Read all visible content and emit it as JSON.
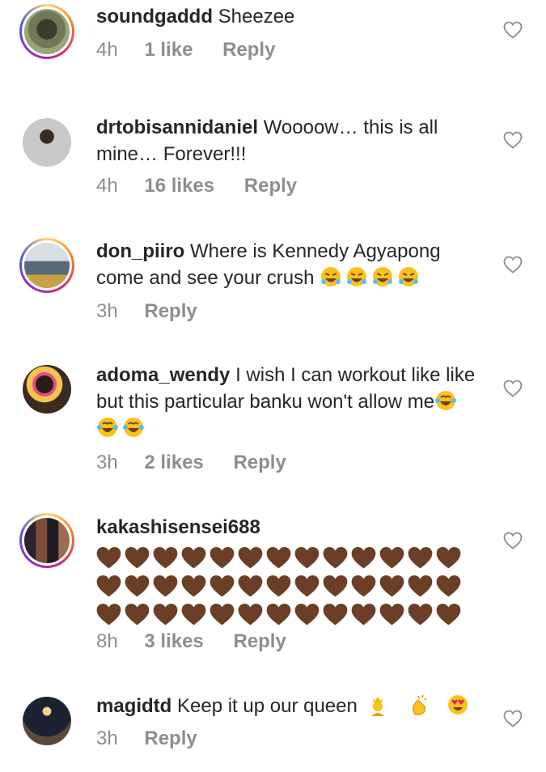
{
  "comments": [
    {
      "username": "soundgaddd",
      "text": "Sheezee",
      "time": "4h",
      "likes": "1 like",
      "reply": "Reply",
      "avatar_ring": true
    },
    {
      "username": "drtobisannidaniel",
      "text": "Woooow… this is all mine… Forever!!!",
      "time": "4h",
      "likes": "16 likes",
      "reply": "Reply",
      "avatar_ring": false
    },
    {
      "username": "don_piiro",
      "text": "Where is Kennedy Agyapong come and see your crush",
      "emojis": [
        "rofl-emoji",
        "rofl-emoji",
        "rofl-emoji",
        "rofl-emoji"
      ],
      "time": "3h",
      "likes": "",
      "reply": "Reply",
      "avatar_ring": true
    },
    {
      "username": "adoma_wendy",
      "text": "I wish I can workout like like but this particular banku won't allow me",
      "emojis": [
        "tears-of-joy-emoji",
        "tears-of-joy-emoji",
        "tears-of-joy-emoji"
      ],
      "time": "3h",
      "likes": "2 likes",
      "reply": "Reply",
      "avatar_ring": false
    },
    {
      "username": "kakashisensei688",
      "text": "",
      "brown_heart_rows": 3,
      "brown_hearts_per_row": 13,
      "time": "8h",
      "likes": "3 likes",
      "reply": "Reply",
      "avatar_ring": true
    },
    {
      "username": "magidtd",
      "text": "Keep it up our queen",
      "emojis": [
        "woman-with-crown-emoji",
        "clapping-hands-emoji",
        "heart-eyes-emoji"
      ],
      "time": "3h",
      "likes": "",
      "reply": "Reply",
      "avatar_ring": false
    }
  ],
  "colors": {
    "text": "#262626",
    "meta": "#8e8e8e",
    "brown_heart": "#6b3e26"
  },
  "icons": {
    "like": "heart-outline-icon"
  }
}
